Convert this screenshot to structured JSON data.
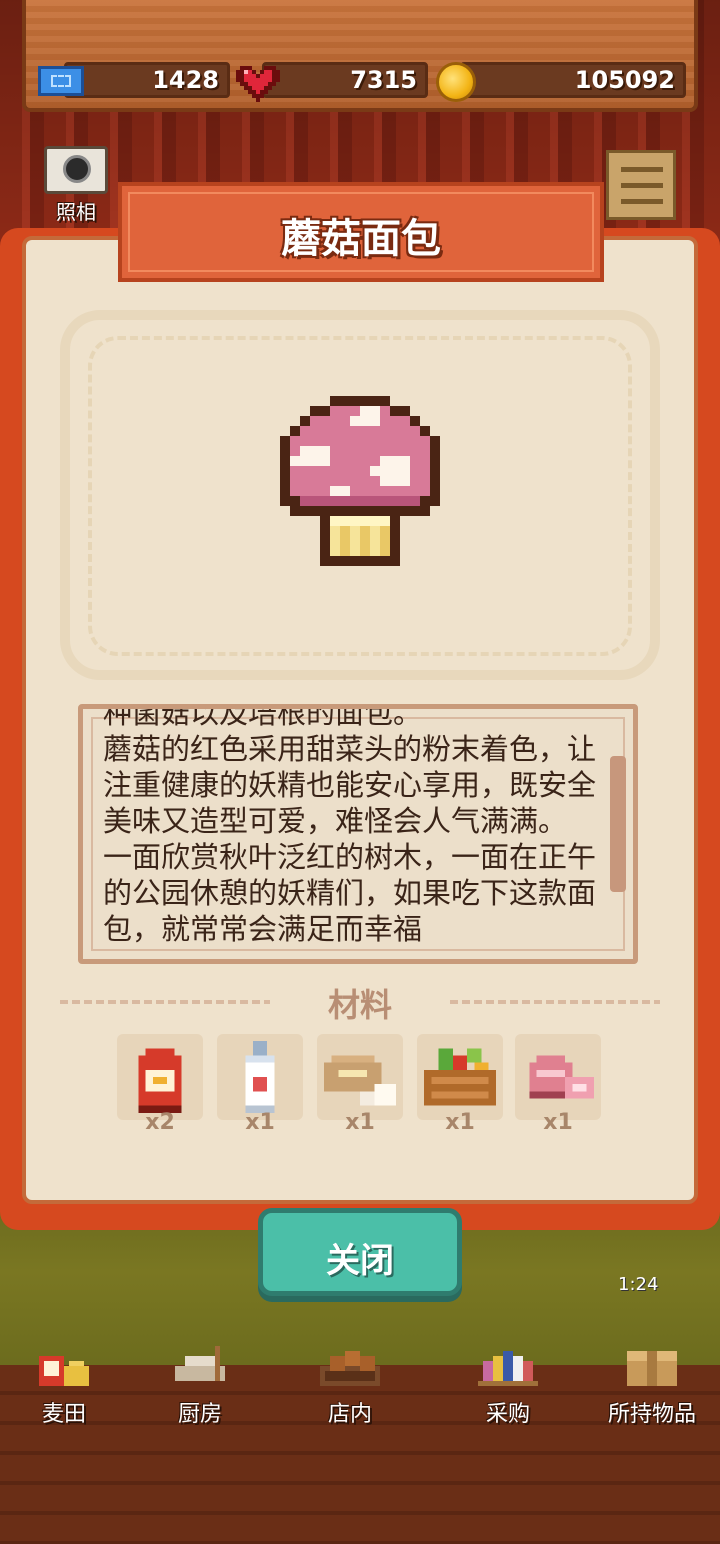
{
  "resources": {
    "tickets": "1428",
    "hearts": "7315",
    "coins": "105092"
  },
  "camera": {
    "label": "照相"
  },
  "recipe": {
    "title": "蘑菇面包",
    "description": "种菌菇以及培根的面包。\n蘑菇的红色采用甜菜头的粉末着色，让注重健康的妖精也能安心享用，既安全美味又造型可爱，难怪会人气满满。\n一面欣赏秋叶泛红的树木，一面在正午的公园休憩的妖精们，如果吃下这款面包，就常常会满足而幸福",
    "materials_title": "材料",
    "materials": [
      {
        "icon": "flour-bag-icon",
        "count": "x2"
      },
      {
        "icon": "milk-bottle-icon",
        "count": "x1"
      },
      {
        "icon": "bread-and-eggs-icon",
        "count": "x1"
      },
      {
        "icon": "vegetable-basket-icon",
        "count": "x1"
      },
      {
        "icon": "meat-icon",
        "count": "x1"
      }
    ]
  },
  "close_label": "关闭",
  "timer": "1:24",
  "nav": [
    {
      "label": "麦田",
      "icon": "wheat-field-icon"
    },
    {
      "label": "厨房",
      "icon": "kitchen-icon"
    },
    {
      "label": "店内",
      "icon": "shop-icon"
    },
    {
      "label": "采购",
      "icon": "purchase-icon"
    },
    {
      "label": "所持物品",
      "icon": "inventory-box-icon"
    }
  ],
  "colors": {
    "ribbon": "#e0643b",
    "book_cover": "#d6491f",
    "page": "#efe2cc",
    "close_button": "#4bbfa8"
  }
}
